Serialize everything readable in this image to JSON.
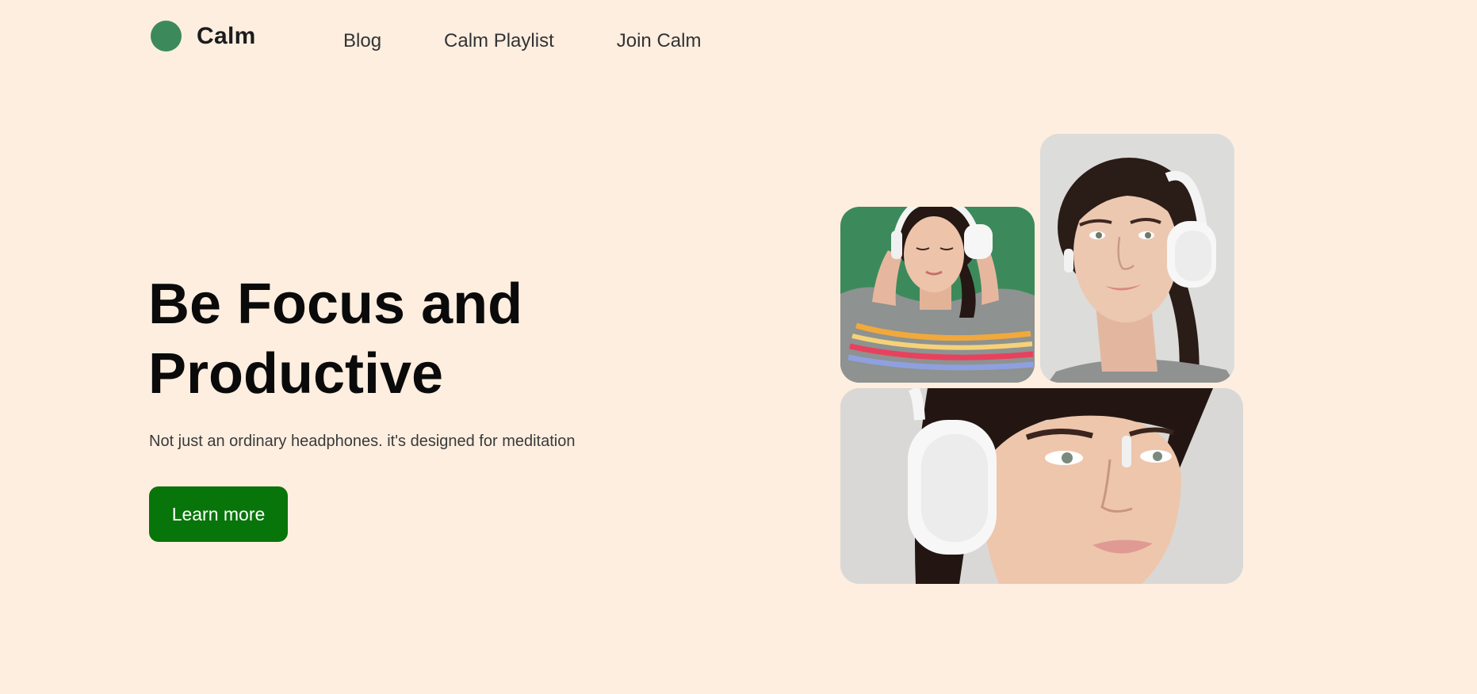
{
  "brand": {
    "name": "Calm",
    "dot_color": "#3C8A5B"
  },
  "nav": {
    "items": [
      "Blog",
      "Calm Playlist",
      "Join Calm"
    ]
  },
  "hero": {
    "title_line1": "Be Focus and",
    "title_line2": "Productive",
    "subtitle": "Not just an ordinary headphones. it's designed for meditation",
    "cta_label": "Learn more",
    "cta_color": "#08750A"
  },
  "colors": {
    "background": "#FDEEE0",
    "photo_green": "#3C8A5B",
    "photo_gray": "#DCDCDA"
  },
  "gallery": {
    "photos": [
      {
        "subject": "woman-headphones-green-background"
      },
      {
        "subject": "woman-headphones-smiling-portrait"
      },
      {
        "subject": "woman-headphones-closeup"
      }
    ]
  }
}
